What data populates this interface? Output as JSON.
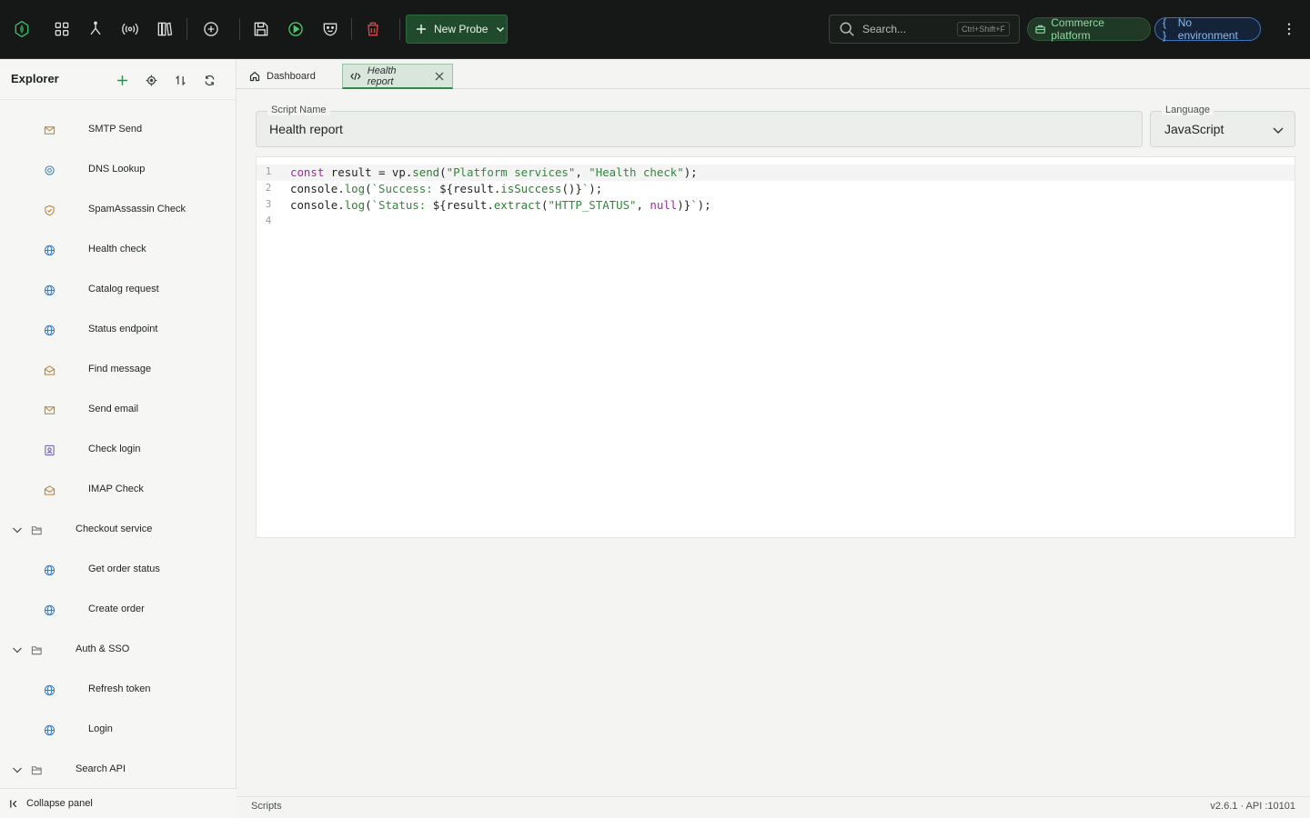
{
  "toolbar": {
    "new_probe_label": "New Probe",
    "search_placeholder": "Search...",
    "search_shortcut": "Ctrl+Shift+F",
    "workspace_label": "Commerce platform",
    "environment_label": "No environment"
  },
  "sidebar": {
    "title": "Explorer",
    "items": [
      {
        "label": "SMTP Send",
        "icon": "mail-icon"
      },
      {
        "label": "DNS Lookup",
        "icon": "target-icon"
      },
      {
        "label": "SpamAssassin Check",
        "icon": "shield-check-icon"
      },
      {
        "label": "Health check",
        "icon": "globe-icon"
      },
      {
        "label": "Catalog request",
        "icon": "globe-icon"
      },
      {
        "label": "Status endpoint",
        "icon": "globe-icon"
      },
      {
        "label": "Find message",
        "icon": "mail-open-icon"
      },
      {
        "label": "Send email",
        "icon": "mail-icon"
      },
      {
        "label": "Check login",
        "icon": "contact-card-icon"
      },
      {
        "label": "IMAP Check",
        "icon": "mail-open-icon"
      },
      {
        "label": "Checkout service",
        "icon": "folder-open-icon"
      },
      {
        "label": "Get order status",
        "icon": "globe-icon"
      },
      {
        "label": "Create order",
        "icon": "globe-icon"
      },
      {
        "label": "Auth & SSO",
        "icon": "folder-open-icon"
      },
      {
        "label": "Refresh token",
        "icon": "globe-icon"
      },
      {
        "label": "Login",
        "icon": "globe-icon"
      },
      {
        "label": "Search API",
        "icon": "folder-open-icon"
      }
    ],
    "collapse_label": "Collapse panel"
  },
  "tabs": [
    {
      "label": "Dashboard",
      "icon": "home-icon"
    },
    {
      "label": "Health report",
      "icon": "code-icon"
    }
  ],
  "form": {
    "script_name_label": "Script Name",
    "script_name_value": "Health report",
    "language_label": "Language",
    "language_value": "JavaScript"
  },
  "editor": {
    "line_numbers": [
      "1",
      "2",
      "3",
      "4"
    ],
    "lines": [
      "const result = vp.send(\"Platform services\", \"Health check\");",
      "console.log(`Success: ${result.isSuccess()}`);",
      "console.log(`Status: ${result.extract(\"HTTP_STATUS\", null)}`);",
      ""
    ]
  },
  "statusbar": {
    "left": "Scripts",
    "right": "v2.6.1 · API :10101"
  },
  "colors": {
    "topbar_bg": "#151816",
    "accent_green": "#2c8a4a",
    "workspace_text": "#8fd9a2",
    "environment_text": "#8cbaf3",
    "delete_red": "#e0464a"
  }
}
